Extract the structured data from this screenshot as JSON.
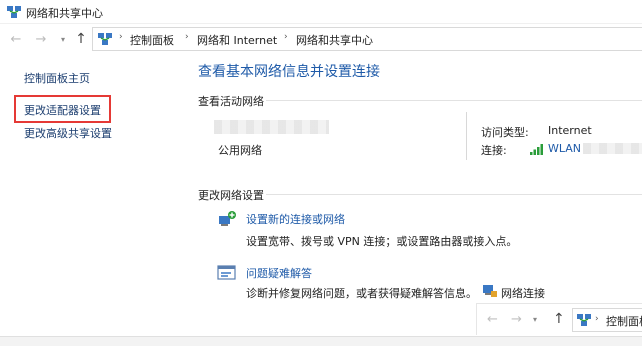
{
  "window": {
    "title": "网络和共享中心"
  },
  "nav": {
    "back_glyph": "←",
    "forward_glyph": "→",
    "dropdown_glyph": "▾",
    "up_glyph": "↑",
    "crumb_separator": "›",
    "breadcrumbs": [
      "控制面板",
      "网络和 Internet",
      "网络和共享中心"
    ]
  },
  "sidebar": {
    "home": "控制面板主页",
    "adapter_settings": "更改适配器设置",
    "advanced_sharing": "更改高级共享设置"
  },
  "main": {
    "title": "查看基本网络信息并设置连接",
    "active_networks": {
      "heading": "查看活动网络",
      "network_type": "公用网络",
      "access_type_label": "访问类型:",
      "access_type_value": "Internet",
      "connection_label": "连接:",
      "connection_value": "WLAN"
    },
    "change_settings": {
      "heading": "更改网络设置",
      "new_connection": {
        "link": "设置新的连接或网络",
        "desc": "设置宽带、拨号或 VPN 连接；或设置路由器或接入点。"
      },
      "troubleshoot": {
        "link": "问题疑难解答",
        "desc": "诊断并修复网络问题，或者获得疑难解答信息。",
        "inline_link": "网络连接"
      }
    }
  },
  "overlay_nav": {
    "crumb": "控制面板"
  },
  "colors": {
    "link": "#1e5aa8",
    "sidebar_link": "#1a3c6e",
    "highlight": "#e53935"
  },
  "icons": [
    "network-center-icon",
    "arrow-left-icon",
    "arrow-right-icon",
    "chevron-down-icon",
    "arrow-up-icon",
    "wifi-signal-icon",
    "new-connection-icon",
    "troubleshoot-icon",
    "network-connections-icon"
  ]
}
